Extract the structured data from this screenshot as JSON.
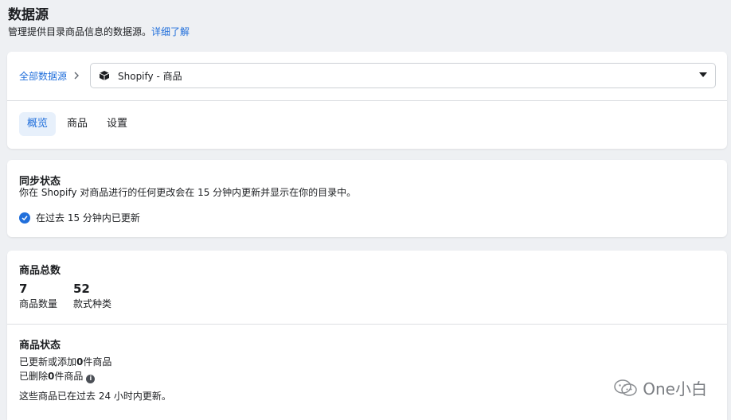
{
  "header": {
    "title": "数据源",
    "subtitle": "管理提供目录商品信息的数据源。",
    "learn_more": "详细了解"
  },
  "breadcrumb": {
    "root": "全部数据源",
    "selected_source": "Shopify - 商品"
  },
  "tabs": [
    {
      "label": "概览",
      "active": true
    },
    {
      "label": "商品",
      "active": false
    },
    {
      "label": "设置",
      "active": false
    }
  ],
  "sync": {
    "title": "同步状态",
    "description": "你在 Shopify 对商品进行的任何更改会在 15 分钟内更新并显示在你的目录中。",
    "status": "在过去 15 分钟内已更新"
  },
  "totals": {
    "title": "商品总数",
    "items": [
      {
        "value": "7",
        "label": "商品数量"
      },
      {
        "value": "52",
        "label": "款式种类"
      }
    ]
  },
  "product_status": {
    "title": "商品状态",
    "updated_prefix": "已更新或添加",
    "updated_count": "0",
    "updated_suffix": "件商品",
    "deleted_prefix": "已删除",
    "deleted_count": "0",
    "deleted_suffix": "件商品",
    "footer": "这些商品已在过去 24 小时内更新。"
  },
  "watermark": "One小白",
  "colors": {
    "accent": "#216fdb",
    "background": "#eef0f3"
  }
}
